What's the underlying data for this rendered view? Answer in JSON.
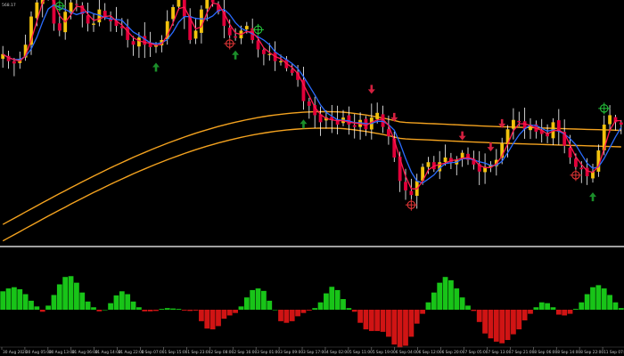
{
  "header": {
    "price_fragment": "568.17"
  },
  "colors": {
    "background": "#000000",
    "bull_candle": "#f2c20d",
    "bear_candle": "#e2003a",
    "wick": "#ffffff",
    "fast_ma_red": "#ff1a50",
    "fast_ma_blue": "#2a6cff",
    "slow_band": "#f3a21f",
    "hist_positive": "#18c418",
    "hist_negative": "#d01414",
    "buy_arrow": "#1b8e2a",
    "sell_arrow": "#d3203f",
    "swing_marker": "#24c23a",
    "swing_low_marker": "#e23636",
    "separator": "#ffffff",
    "axis_text": "#c8c8c8"
  },
  "icons": {
    "buy": "arrow-up-icon",
    "sell": "arrow-down-icon",
    "swing": "crosshair-target-icon"
  },
  "axis": {
    "time_labels": [
      "30 Aug 2020",
      "30 Aug 05:00",
      "30 Aug 13:00",
      "31 Aug 06:00",
      "31 Aug 14:00",
      "31 Aug 22:00",
      "1 Sep 07:00",
      "1 Sep 15:00",
      "1 Sep 23:00",
      "2 Sep 08:00",
      "2 Sep 16:00",
      "3 Sep 01:00",
      "3 Sep 09:00",
      "3 Sep 17:00",
      "4 Sep 02:00",
      "5 Sep 11:00",
      "5 Sep 19:00",
      "6 Sep 04:00",
      "6 Sep 12:00",
      "6 Sep 20:00",
      "7 Sep 05:00",
      "7 Sep 13:00",
      "7 Sep 21:00",
      "8 Sep 06:00",
      "8 Sep 14:00",
      "8 Sep 22:00",
      "11 Sep 07:00"
    ]
  },
  "chart_data": [
    {
      "type": "candlestick",
      "title": "",
      "close": [
        0.8,
        0.77,
        0.76,
        0.78,
        0.84,
        0.96,
        1.02,
        1.08,
        1.06,
        0.93,
        0.9,
        0.98,
        1.02,
        1.01,
        0.97,
        0.93,
        0.93,
        0.99,
        0.96,
        0.94,
        0.92,
        0.91,
        0.86,
        0.84,
        0.87,
        0.84,
        0.83,
        0.84,
        0.86,
        0.94,
        1.0,
        1.04,
        0.96,
        0.86,
        0.9,
        0.99,
        1.04,
        1.02,
        0.98,
        0.92,
        0.88,
        0.87,
        0.9,
        0.92,
        0.86,
        0.82,
        0.8,
        0.8,
        0.77,
        0.77,
        0.74,
        0.72,
        0.69,
        0.6,
        0.58,
        0.54,
        0.51,
        0.53,
        0.52,
        0.5,
        0.53,
        0.5,
        0.49,
        0.52,
        0.48,
        0.53,
        0.55,
        0.49,
        0.45,
        0.36,
        0.26,
        0.22,
        0.2,
        0.26,
        0.32,
        0.34,
        0.31,
        0.34,
        0.36,
        0.34,
        0.35,
        0.38,
        0.35,
        0.33,
        0.3,
        0.32,
        0.33,
        0.35,
        0.42,
        0.48,
        0.52,
        0.51,
        0.48,
        0.5,
        0.47,
        0.46,
        0.45,
        0.51,
        0.47,
        0.41,
        0.36,
        0.32,
        0.31,
        0.28,
        0.3,
        0.39,
        0.5,
        0.54,
        0.51,
        0.5
      ],
      "overlays": [
        "fast MA (red)",
        "fast MA (blue)",
        "slow MA band (orange, 2 lines)"
      ],
      "buy_arrows_at_bar": [
        27,
        41,
        53,
        104
      ],
      "sell_arrows_at_bar": [
        65,
        69,
        81,
        86,
        88
      ],
      "swing_high_markers_at_bar": [
        10,
        45,
        106
      ],
      "swing_low_markers_at_bar": [
        40,
        72,
        101
      ]
    },
    {
      "type": "histogram",
      "title": "",
      "zero_line": 0,
      "values": [
        0.45,
        0.52,
        0.55,
        0.5,
        0.38,
        0.22,
        0.08,
        -0.05,
        0.1,
        0.36,
        0.62,
        0.8,
        0.82,
        0.66,
        0.42,
        0.2,
        0.06,
        -0.04,
        0.0,
        0.16,
        0.35,
        0.45,
        0.38,
        0.2,
        0.06,
        -0.04,
        -0.04,
        -0.03,
        0.02,
        0.04,
        0.03,
        0.02,
        -0.02,
        -0.03,
        -0.02,
        -0.28,
        -0.46,
        -0.48,
        -0.4,
        -0.22,
        -0.14,
        -0.08,
        0.08,
        0.3,
        0.48,
        0.52,
        0.46,
        0.22,
        0.0,
        -0.28,
        -0.32,
        -0.28,
        -0.16,
        -0.08,
        -0.02,
        0.04,
        0.18,
        0.4,
        0.56,
        0.48,
        0.26,
        0.04,
        -0.05,
        -0.32,
        -0.48,
        -0.52,
        -0.52,
        -0.54,
        -0.66,
        -0.85,
        -0.92,
        -0.88,
        -0.66,
        -0.34,
        -0.1,
        0.18,
        0.42,
        0.66,
        0.8,
        0.72,
        0.52,
        0.3,
        0.1,
        -0.03,
        -0.3,
        -0.58,
        -0.7,
        -0.78,
        -0.82,
        -0.74,
        -0.6,
        -0.48,
        -0.26,
        -0.1,
        0.06,
        0.18,
        0.16,
        0.06,
        -0.12,
        -0.14,
        -0.1,
        0.02,
        0.18,
        0.38,
        0.55,
        0.6,
        0.52,
        0.36,
        0.18,
        0.04
      ]
    }
  ]
}
